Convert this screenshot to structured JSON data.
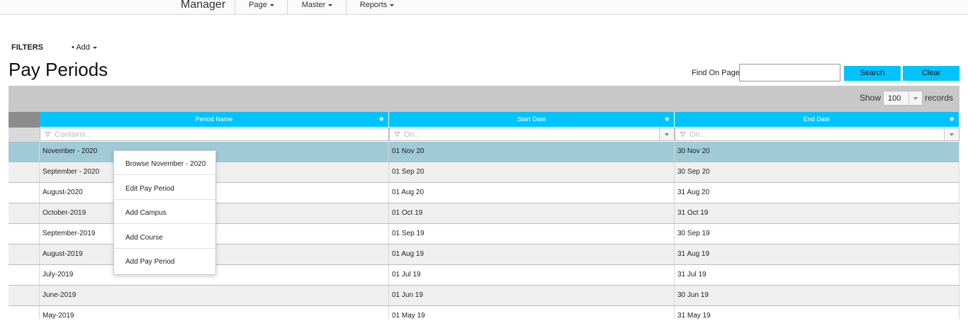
{
  "app": {
    "title": "Manager"
  },
  "nav": [
    {
      "label": "Page"
    },
    {
      "label": "Master"
    },
    {
      "label": "Reports"
    }
  ],
  "filters": {
    "label": "FILTERS",
    "add_label": "Add"
  },
  "page": {
    "title": "Pay Periods"
  },
  "find": {
    "label": "Find On Page",
    "value": "",
    "search_label": "Search",
    "clear_label": "Clear"
  },
  "paging": {
    "show_label": "Show",
    "page_size": "100",
    "records_label": "records"
  },
  "columns": [
    {
      "label": "Period Name",
      "filter_placeholder": "Contains..."
    },
    {
      "label": "Start Date",
      "filter_placeholder": "On..."
    },
    {
      "label": "End Date",
      "filter_placeholder": "On..."
    }
  ],
  "rows": [
    {
      "name": "November - 2020",
      "start": "01 Nov 20",
      "end": "30 Nov 20"
    },
    {
      "name": "September - 2020",
      "start": "01 Sep 20",
      "end": "30 Sep 20"
    },
    {
      "name": "August-2020",
      "start": "01 Aug 20",
      "end": "31 Aug 20"
    },
    {
      "name": "October-2019",
      "start": "01 Oct 19",
      "end": "31 Oct 19"
    },
    {
      "name": "September-2019",
      "start": "01 Sep 19",
      "end": "30 Sep 19"
    },
    {
      "name": "August-2019",
      "start": "01 Aug 19",
      "end": "31 Aug 19"
    },
    {
      "name": "July-2019",
      "start": "01 Jul 19",
      "end": "31 Jul 19"
    },
    {
      "name": "June-2019",
      "start": "01 Jun 19",
      "end": "30 Jun 19"
    },
    {
      "name": "May-2019",
      "start": "01 May 19",
      "end": "31 May 19"
    }
  ],
  "context_menu": [
    {
      "label": "Browse November - 2020"
    },
    {
      "label": "Edit Pay Period"
    },
    {
      "label": "Add Campus"
    },
    {
      "label": "Add Course"
    },
    {
      "label": "Add Pay Period"
    }
  ],
  "colors": {
    "accent": "#00c3ff",
    "selected_row": "#9fcad6",
    "alt_row": "#efefef",
    "toolbar_bg": "#c8c8c8"
  }
}
